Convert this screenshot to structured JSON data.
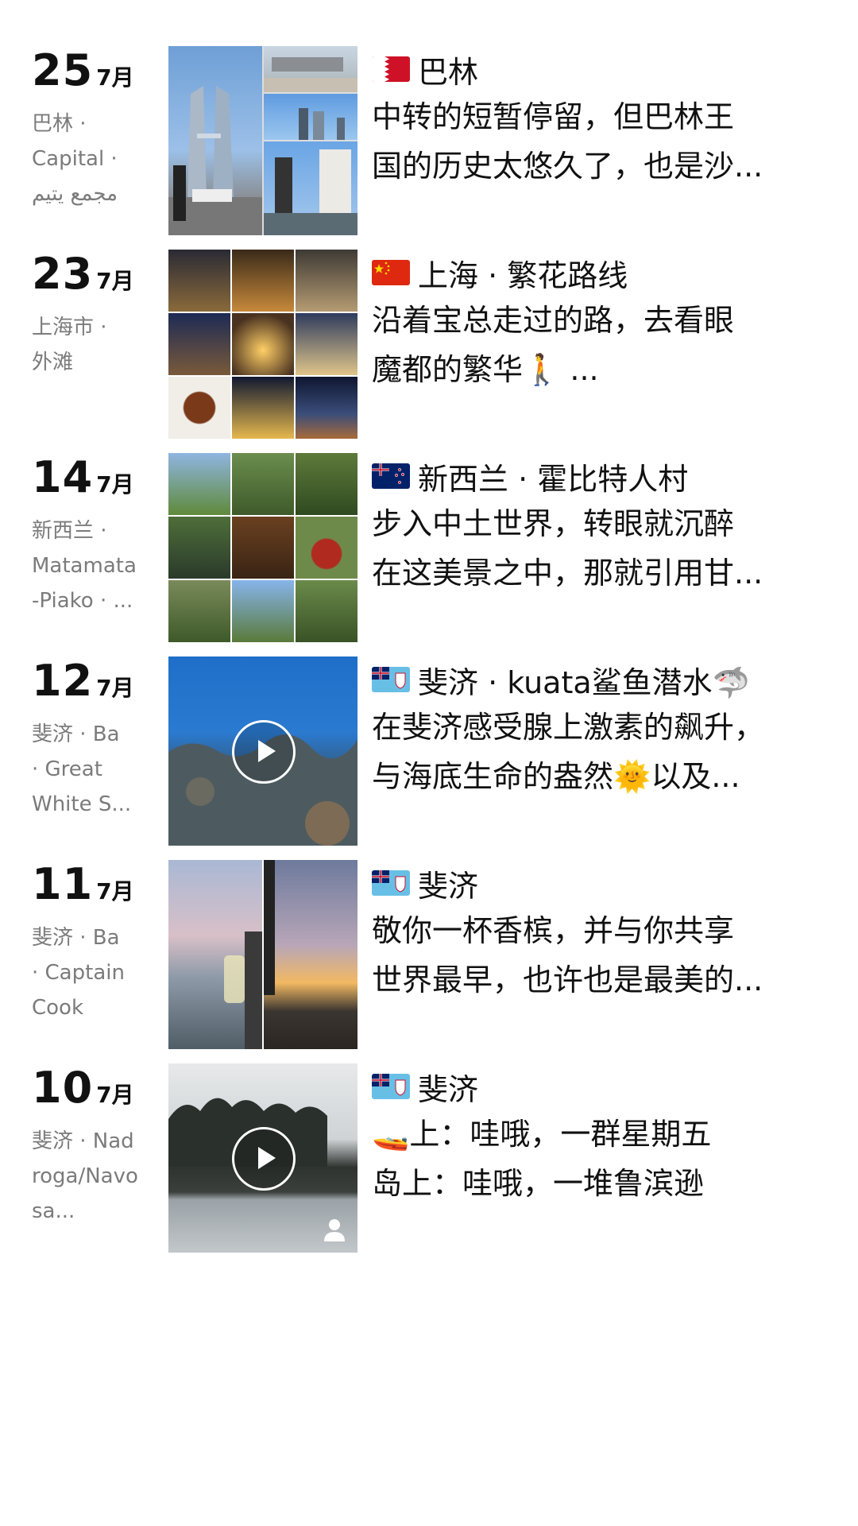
{
  "posts": [
    {
      "day": "25",
      "month": "7月",
      "location": "巴林 · \nCapital · \nمجمع يتيم",
      "flag": "bahrain-flag-icon",
      "title": "巴林",
      "lines": [
        "中转的短暂停留，但巴林王",
        "国的历史太悠久了，也是沙..."
      ],
      "media": "photo-collage"
    },
    {
      "day": "23",
      "month": "7月",
      "location": "上海市 · \n外滩",
      "flag": "china-flag-icon",
      "title": "上海 · 繁花路线",
      "lines": [
        "沿着宝总走过的路，去看眼",
        "魔都的繁华🚶 ..."
      ],
      "media": "photo-grid"
    },
    {
      "day": "14",
      "month": "7月",
      "location": "新西兰 · \nMatamata\n-Piako · ...",
      "flag": "new-zealand-flag-icon",
      "title": "新西兰 · 霍比特人村",
      "lines": [
        "步入中土世界，转眼就沉醉",
        "在这美景之中，那就引用甘..."
      ],
      "media": "photo-grid"
    },
    {
      "day": "12",
      "month": "7月",
      "location": "斐济 · Ba\n· Great\nWhite S...",
      "flag": "fiji-flag-icon",
      "title": "斐济 · kuata鲨鱼潜水🦈",
      "lines": [
        "在斐济感受腺上激素的飙升，",
        "与海底生命的盎然🌞以及..."
      ],
      "media": "video"
    },
    {
      "day": "11",
      "month": "7月",
      "location": "斐济 · Ba\n· Captain\nCook",
      "flag": "fiji-flag-icon",
      "title": "斐济",
      "lines": [
        "敬你一杯香槟，并与你共享",
        "世界最早，也许也是最美的..."
      ],
      "media": "photo-pair"
    },
    {
      "day": "10",
      "month": "7月",
      "location": "斐济 · Nad\nroga/Navo\nsa...",
      "flag": "fiji-flag-icon",
      "title": "斐济",
      "lines": [
        "🚤上：哇哦，一群星期五",
        "岛上：哇哦，一堆鲁滨逊"
      ],
      "media": "video-private"
    }
  ]
}
